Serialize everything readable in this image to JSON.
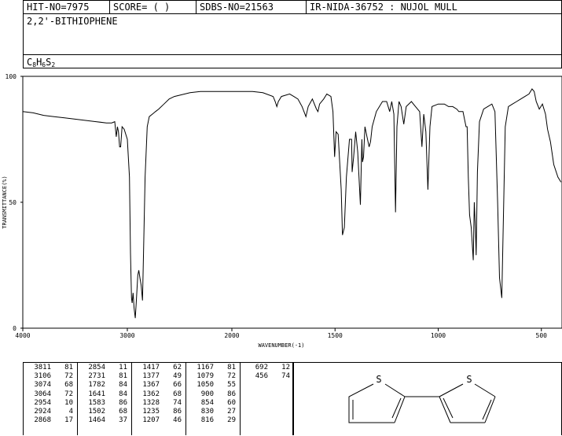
{
  "header": {
    "hit_no": "HIT-NO=7975",
    "score": "SCORE=  (   )",
    "sdbs_no": "SDBS-NO=21563",
    "ir_info": "IR-NIDA-36752 : NUJOL MULL"
  },
  "compound": {
    "name": "2,2'-BITHIOPHENE",
    "formula_parts": [
      "C",
      "8",
      "H",
      "6",
      "S",
      "2"
    ]
  },
  "chart_data": {
    "type": "line",
    "xlabel": "WAVENUMBER(-1)",
    "ylabel": "TRANSMITTANCE(%)",
    "xlim": [
      4000,
      400
    ],
    "ylim": [
      0,
      100
    ],
    "x_ticks": [
      4000,
      3000,
      2000,
      1500,
      1000,
      500
    ],
    "x_tick_labels": [
      "4000",
      "3000",
      "2000",
      "1500",
      "1000",
      "500"
    ],
    "y_ticks": [
      0,
      50,
      100
    ],
    "y_tick_labels": [
      "0",
      "50",
      "100"
    ],
    "spectrum": [
      [
        4000,
        86
      ],
      [
        3900,
        85.5
      ],
      [
        3800,
        84.5
      ],
      [
        3700,
        84
      ],
      [
        3600,
        83.5
      ],
      [
        3500,
        83
      ],
      [
        3400,
        82.5
      ],
      [
        3300,
        82
      ],
      [
        3200,
        81.5
      ],
      [
        3150,
        81.5
      ],
      [
        3120,
        82
      ],
      [
        3106,
        76
      ],
      [
        3095,
        80
      ],
      [
        3085,
        78
      ],
      [
        3074,
        72
      ],
      [
        3064,
        72
      ],
      [
        3050,
        80
      ],
      [
        3030,
        79
      ],
      [
        3000,
        75
      ],
      [
        2980,
        60
      ],
      [
        2970,
        30
      ],
      [
        2960,
        12
      ],
      [
        2954,
        10
      ],
      [
        2945,
        14
      ],
      [
        2935,
        8
      ],
      [
        2924,
        4
      ],
      [
        2915,
        10
      ],
      [
        2900,
        21
      ],
      [
        2890,
        23
      ],
      [
        2880,
        20
      ],
      [
        2868,
        17
      ],
      [
        2855,
        11
      ],
      [
        2845,
        30
      ],
      [
        2830,
        60
      ],
      [
        2810,
        80
      ],
      [
        2790,
        84
      ],
      [
        2760,
        85
      ],
      [
        2731,
        86
      ],
      [
        2700,
        87
      ],
      [
        2650,
        89
      ],
      [
        2600,
        91
      ],
      [
        2550,
        92
      ],
      [
        2500,
        92.5
      ],
      [
        2400,
        93.5
      ],
      [
        2300,
        94
      ],
      [
        2200,
        94
      ],
      [
        2100,
        94
      ],
      [
        2000,
        94
      ],
      [
        1950,
        94
      ],
      [
        1900,
        94
      ],
      [
        1850,
        93.5
      ],
      [
        1800,
        92
      ],
      [
        1790,
        90
      ],
      [
        1782,
        88
      ],
      [
        1775,
        90
      ],
      [
        1760,
        92
      ],
      [
        1720,
        93
      ],
      [
        1700,
        92
      ],
      [
        1680,
        91
      ],
      [
        1660,
        88
      ],
      [
        1641,
        84
      ],
      [
        1630,
        88
      ],
      [
        1610,
        91
      ],
      [
        1590,
        87
      ],
      [
        1583,
        86
      ],
      [
        1575,
        89
      ],
      [
        1555,
        91
      ],
      [
        1540,
        93
      ],
      [
        1520,
        92
      ],
      [
        1510,
        86
      ],
      [
        1502,
        68
      ],
      [
        1495,
        78
      ],
      [
        1485,
        77
      ],
      [
        1470,
        55
      ],
      [
        1464,
        37
      ],
      [
        1455,
        40
      ],
      [
        1445,
        60
      ],
      [
        1430,
        75
      ],
      [
        1420,
        75
      ],
      [
        1417,
        62
      ],
      [
        1410,
        68
      ],
      [
        1400,
        78
      ],
      [
        1390,
        70
      ],
      [
        1377,
        49
      ],
      [
        1370,
        75
      ],
      [
        1367,
        66
      ],
      [
        1362,
        68
      ],
      [
        1355,
        80
      ],
      [
        1345,
        76
      ],
      [
        1335,
        72
      ],
      [
        1328,
        74
      ],
      [
        1320,
        80
      ],
      [
        1300,
        86
      ],
      [
        1270,
        90
      ],
      [
        1250,
        90
      ],
      [
        1235,
        86
      ],
      [
        1225,
        90
      ],
      [
        1215,
        85
      ],
      [
        1207,
        46
      ],
      [
        1200,
        80
      ],
      [
        1190,
        90
      ],
      [
        1180,
        88
      ],
      [
        1167,
        81
      ],
      [
        1155,
        88
      ],
      [
        1130,
        90
      ],
      [
        1110,
        88
      ],
      [
        1090,
        86
      ],
      [
        1079,
        72
      ],
      [
        1070,
        85
      ],
      [
        1060,
        78
      ],
      [
        1050,
        55
      ],
      [
        1040,
        80
      ],
      [
        1030,
        88
      ],
      [
        1000,
        89
      ],
      [
        970,
        89
      ],
      [
        950,
        88
      ],
      [
        930,
        88
      ],
      [
        910,
        87
      ],
      [
        900,
        86
      ],
      [
        880,
        86
      ],
      [
        865,
        80
      ],
      [
        860,
        80
      ],
      [
        854,
        60
      ],
      [
        848,
        45
      ],
      [
        840,
        40
      ],
      [
        830,
        27
      ],
      [
        825,
        50
      ],
      [
        820,
        40
      ],
      [
        816,
        29
      ],
      [
        810,
        62
      ],
      [
        800,
        82
      ],
      [
        780,
        87
      ],
      [
        760,
        88
      ],
      [
        740,
        89
      ],
      [
        725,
        86
      ],
      [
        712,
        50
      ],
      [
        703,
        20
      ],
      [
        692,
        12
      ],
      [
        685,
        40
      ],
      [
        675,
        80
      ],
      [
        660,
        88
      ],
      [
        640,
        89
      ],
      [
        620,
        90
      ],
      [
        600,
        91
      ],
      [
        580,
        92
      ],
      [
        560,
        93
      ],
      [
        545,
        95
      ],
      [
        535,
        94
      ],
      [
        525,
        90
      ],
      [
        510,
        87
      ],
      [
        495,
        89
      ],
      [
        480,
        85
      ],
      [
        470,
        79
      ],
      [
        456,
        74
      ],
      [
        440,
        65
      ],
      [
        420,
        60
      ],
      [
        405,
        58
      ]
    ],
    "peaks": [
      [
        3811,
        81
      ],
      [
        3106,
        72
      ],
      [
        3074,
        68
      ],
      [
        3064,
        72
      ],
      [
        2954,
        10
      ],
      [
        2924,
        4
      ],
      [
        2868,
        17
      ],
      [
        2854,
        11
      ],
      [
        2731,
        81
      ],
      [
        1782,
        84
      ],
      [
        1641,
        84
      ],
      [
        1583,
        86
      ],
      [
        1502,
        68
      ],
      [
        1464,
        37
      ],
      [
        1417,
        62
      ],
      [
        1377,
        49
      ],
      [
        1367,
        66
      ],
      [
        1362,
        68
      ],
      [
        1328,
        74
      ],
      [
        1235,
        86
      ],
      [
        1207,
        46
      ],
      [
        1167,
        81
      ],
      [
        1079,
        72
      ],
      [
        1050,
        55
      ],
      [
        900,
        86
      ],
      [
        854,
        60
      ],
      [
        830,
        27
      ],
      [
        816,
        29
      ],
      [
        692,
        12
      ],
      [
        456,
        74
      ]
    ]
  },
  "structure": {
    "atom_labels": [
      "S",
      "S"
    ]
  }
}
